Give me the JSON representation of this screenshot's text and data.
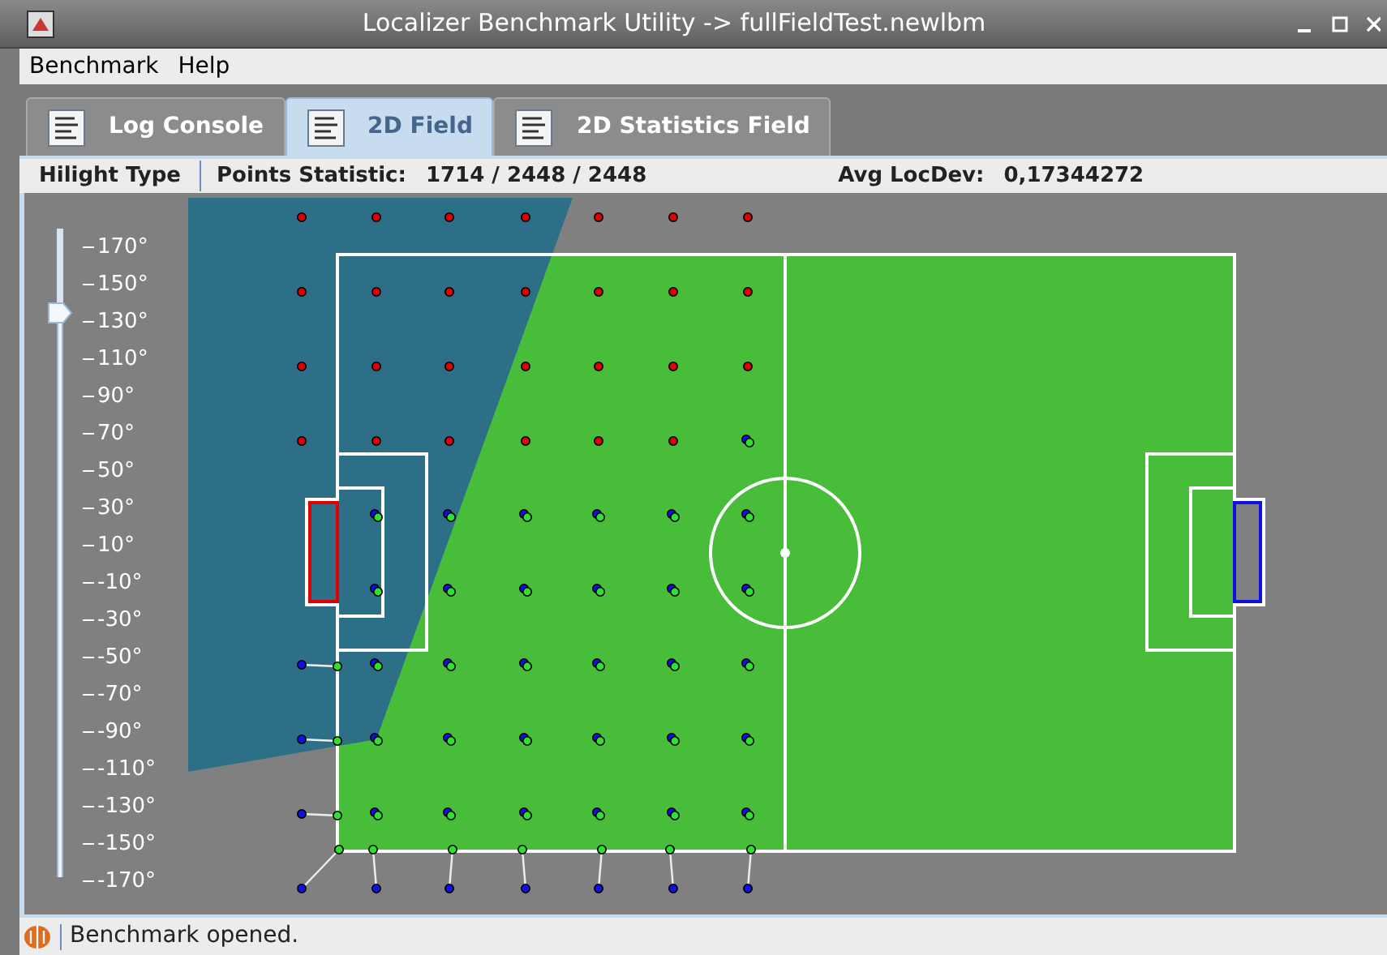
{
  "window": {
    "title": "Localizer Benchmark Utility -> fullFieldTest.newlbm"
  },
  "menu": [
    "Benchmark",
    "Help"
  ],
  "tabs": [
    {
      "label": "Log Console",
      "selected": false
    },
    {
      "label": "2D Field",
      "selected": true
    },
    {
      "label": "2D Statistics Field",
      "selected": false
    }
  ],
  "info_bar": {
    "hilight_type": "Hilight Type",
    "points_label": "Points Statistic:",
    "points_value": "1714 / 2448 / 2448",
    "locdev_label": "Avg LocDev:",
    "locdev_value": "0,17344272"
  },
  "angle_slider": {
    "level": 0.87,
    "ticks": [
      "170°",
      "150°",
      "130°",
      "110°",
      "90°",
      "70°",
      "50°",
      "30°",
      "10°",
      "-10°",
      "-30°",
      "-50°",
      "-70°",
      "-90°",
      "-110°",
      "-130°",
      "-150°",
      "-170°"
    ]
  },
  "status_bar": {
    "text": "Benchmark opened."
  }
}
